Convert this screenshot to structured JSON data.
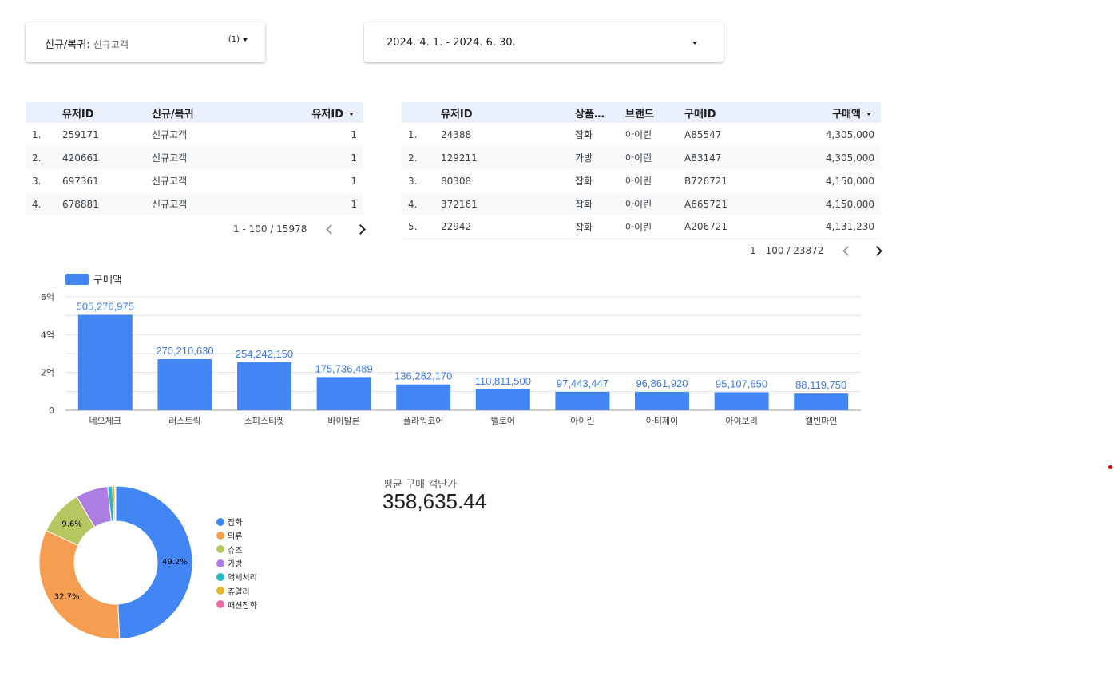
{
  "filters": {
    "segment": {
      "label": "신규/복귀",
      "value": "신규고객",
      "count": "(1)"
    },
    "date_range": {
      "value": "2024. 4. 1. - 2024. 6. 30."
    }
  },
  "table_users": {
    "columns": [
      "유저ID",
      "신규/복귀",
      "유저ID"
    ],
    "rows": [
      {
        "num": "1.",
        "id": "259171",
        "type": "신규고객",
        "count": "1"
      },
      {
        "num": "2.",
        "id": "420661",
        "type": "신규고객",
        "count": "1"
      },
      {
        "num": "3.",
        "id": "697361",
        "type": "신규고객",
        "count": "1"
      },
      {
        "num": "4.",
        "id": "678881",
        "type": "신규고객",
        "count": "1"
      }
    ],
    "pagination": "1 - 100 / 15978"
  },
  "table_purchases": {
    "columns": [
      "유저ID",
      "상품…",
      "브랜드",
      "구매ID",
      "구매액"
    ],
    "rows": [
      {
        "num": "1.",
        "id": "24388",
        "cat": "잡화",
        "brand": "아이린",
        "pid": "A85547",
        "amt": "4,305,000"
      },
      {
        "num": "2.",
        "id": "129211",
        "cat": "가방",
        "brand": "아이린",
        "pid": "A83147",
        "amt": "4,305,000"
      },
      {
        "num": "3.",
        "id": "80308",
        "cat": "잡화",
        "brand": "아이린",
        "pid": "B726721",
        "amt": "4,150,000"
      },
      {
        "num": "4.",
        "id": "372161",
        "cat": "잡화",
        "brand": "아이린",
        "pid": "A665721",
        "amt": "4,150,000"
      },
      {
        "num": "5.",
        "id": "22942",
        "cat": "잡화",
        "brand": "아이린",
        "pid": "A206721",
        "amt": "4,131,230"
      }
    ],
    "pagination": "1 - 100 / 23872"
  },
  "chart_data": [
    {
      "type": "bar",
      "categories": [
        "네오체크",
        "러스트릭",
        "소피스티켓",
        "바이탈론",
        "플라워코어",
        "벨로어",
        "아이린",
        "아티제이",
        "아이보리",
        "캘빈마인"
      ],
      "series": [
        {
          "name": "구매액",
          "values": [
            505276975,
            270210630,
            254242150,
            175736489,
            136282170,
            110811500,
            97443447,
            96861920,
            95107650,
            88119750
          ]
        }
      ],
      "data_labels": [
        "505,276,975",
        "270,210,630",
        "254,242,150",
        "175,736,489",
        "136,282,170",
        "110,811,500",
        "97,443,447",
        "96,861,920",
        "95,107,650",
        "88,119,750"
      ],
      "ylim": [
        0,
        600000000
      ],
      "yticks": [
        0,
        200000000,
        400000000,
        600000000
      ],
      "ytick_labels": [
        "0",
        "2억",
        "4억",
        "6억"
      ],
      "grid": true,
      "legend": "top-left",
      "color": "#4285f4"
    },
    {
      "type": "pie",
      "donut": true,
      "labels": [
        "잡화",
        "의류",
        "슈즈",
        "가방",
        "액세서리",
        "쥬얼리",
        "패션잡화"
      ],
      "values": [
        49.2,
        32.7,
        9.6,
        6.8,
        1.0,
        0.5,
        0.2
      ],
      "value_labels": [
        "49.2%",
        "32.7%",
        "9.6%"
      ],
      "colors": [
        "#4285f4",
        "#f59e51",
        "#b6c762",
        "#ad7de3",
        "#2bb7c4",
        "#e6b82e",
        "#e86da8"
      ],
      "legend": "right"
    }
  ],
  "kpi": {
    "label": "평균 구매 객단가",
    "value": "358,635.44"
  }
}
